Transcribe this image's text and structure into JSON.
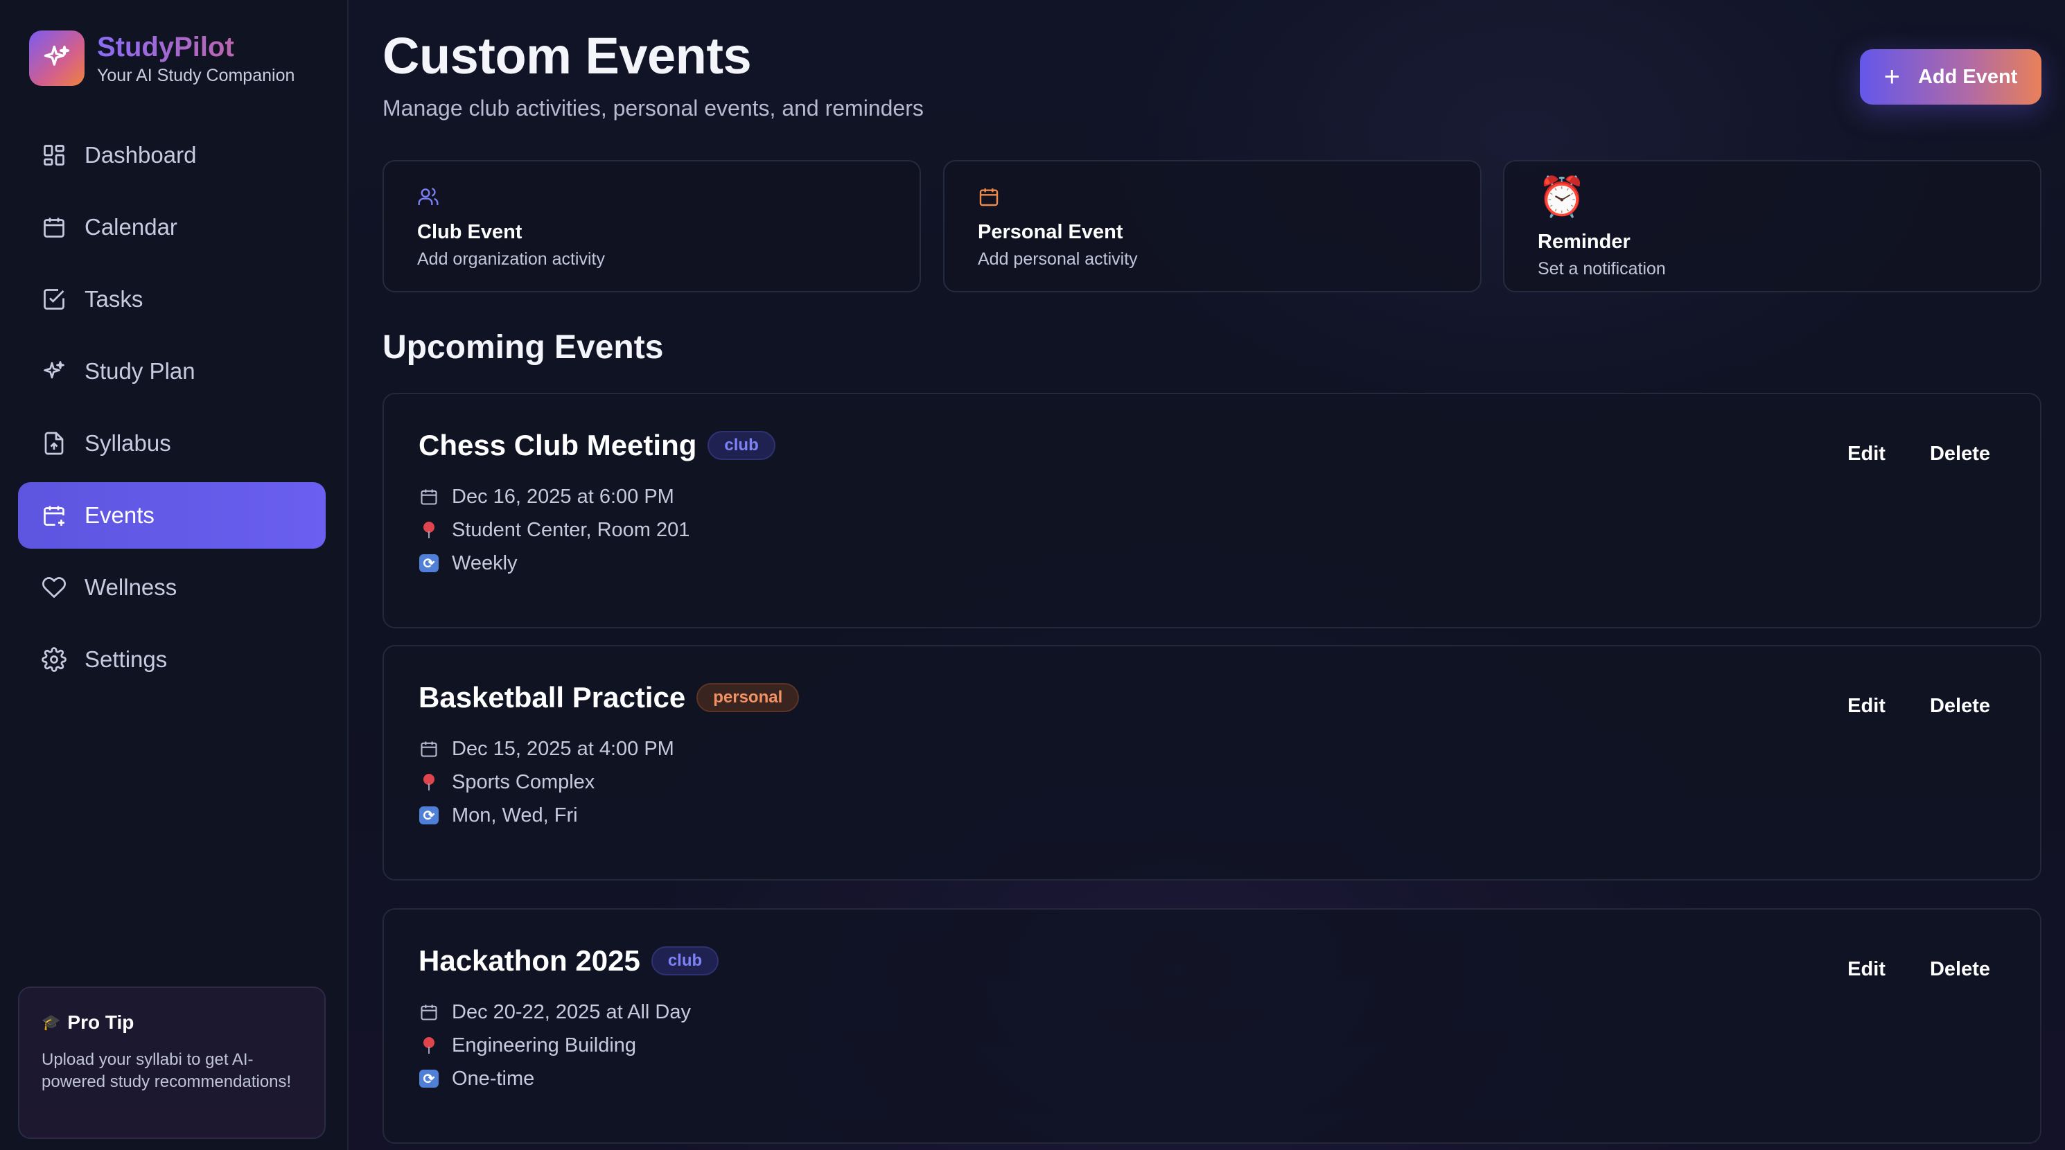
{
  "brand": {
    "name": "StudyPilot",
    "tagline": "Your AI Study Companion"
  },
  "nav": {
    "items": [
      {
        "label": "Dashboard",
        "icon": "grid-icon"
      },
      {
        "label": "Calendar",
        "icon": "calendar-icon"
      },
      {
        "label": "Tasks",
        "icon": "checkbox-icon"
      },
      {
        "label": "Study Plan",
        "icon": "sparkle-icon"
      },
      {
        "label": "Syllabus",
        "icon": "file-upload-icon"
      },
      {
        "label": "Events",
        "icon": "calendar-plus-icon",
        "active": true
      },
      {
        "label": "Wellness",
        "icon": "heart-icon"
      },
      {
        "label": "Settings",
        "icon": "gear-icon"
      }
    ]
  },
  "pro_tip": {
    "title": "Pro Tip",
    "body": "Upload your syllabi to get AI-powered study recommendations!"
  },
  "header": {
    "title": "Custom Events",
    "subtitle": "Manage club activities, personal events, and reminders",
    "add_button": "Add Event"
  },
  "quick_add": [
    {
      "title": "Club Event",
      "subtitle": "Add organization activity",
      "icon": "users-icon",
      "color": "#7b7ff5"
    },
    {
      "title": "Personal Event",
      "subtitle": "Add personal activity",
      "icon": "calendar-icon",
      "color": "#f08a4b"
    },
    {
      "title": "Reminder",
      "subtitle": "Set a notification",
      "icon": "alarm-clock-icon",
      "color": "#e0444c"
    }
  ],
  "upcoming": {
    "title": "Upcoming Events",
    "edit_label": "Edit",
    "delete_label": "Delete",
    "events": [
      {
        "title": "Chess Club Meeting",
        "type": "club",
        "datetime": "Dec 16, 2025 at 6:00 PM",
        "location": "Student Center, Room 201",
        "recurrence": "Weekly"
      },
      {
        "title": "Basketball Practice",
        "type": "personal",
        "datetime": "Dec 15, 2025 at 4:00 PM",
        "location": "Sports Complex",
        "recurrence": "Mon, Wed, Fri"
      },
      {
        "title": "Hackathon 2025",
        "type": "club",
        "datetime": "Dec 20-22, 2025 at All Day",
        "location": "Engineering Building",
        "recurrence": "One-time"
      }
    ]
  },
  "colors": {
    "accent": "#6457ea",
    "club_badge": "#7d83f5",
    "personal_badge": "#f29164",
    "background": "#0e1120"
  }
}
